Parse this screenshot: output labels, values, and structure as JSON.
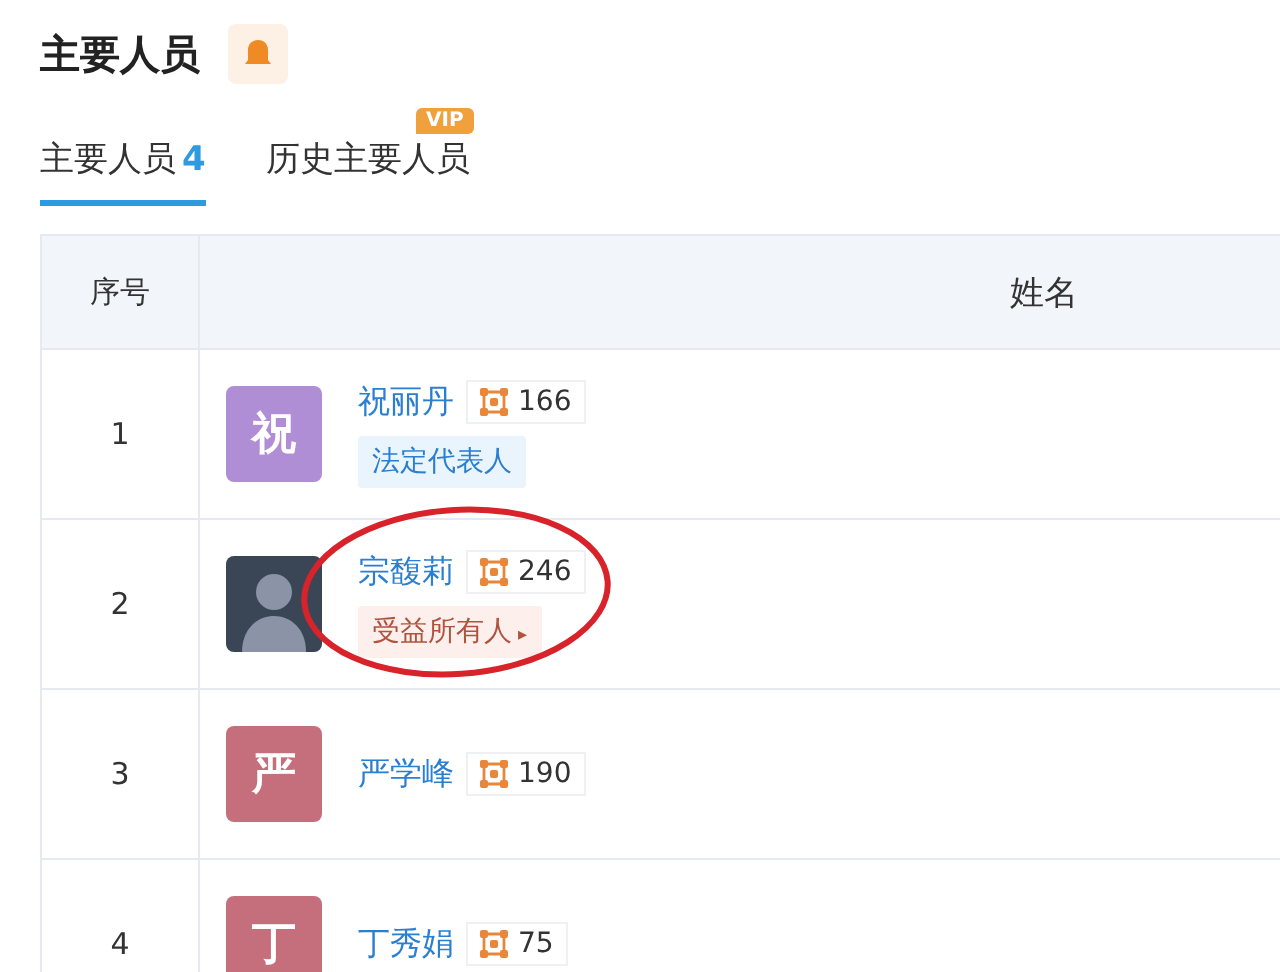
{
  "title": "主要人员",
  "tabs": [
    {
      "label": "主要人员",
      "count": "4",
      "selected": true,
      "vip": false
    },
    {
      "label": "历史主要人员",
      "selected": false,
      "vip": true
    }
  ],
  "vip_badge": "VIP",
  "table": {
    "columns": [
      "序号",
      "姓名"
    ],
    "rows": [
      {
        "index": "1",
        "avatar": {
          "kind": "letter",
          "text": "祝",
          "color": "#b08ed6"
        },
        "name": "祝丽丹",
        "related": "166",
        "tag": {
          "text": "法定代表人",
          "kind": "role"
        }
      },
      {
        "index": "2",
        "avatar": {
          "kind": "photo"
        },
        "name": "宗馥莉",
        "related": "246",
        "tag": {
          "text": "受益所有人",
          "kind": "owner",
          "arrow": "▸"
        },
        "circled": true
      },
      {
        "index": "3",
        "avatar": {
          "kind": "letter",
          "text": "严",
          "color": "#c66f7c"
        },
        "name": "严学峰",
        "related": "190"
      },
      {
        "index": "4",
        "avatar": {
          "kind": "letter",
          "text": "丁",
          "color": "#c66f7c"
        },
        "name": "丁秀娟",
        "related": "75"
      }
    ]
  }
}
